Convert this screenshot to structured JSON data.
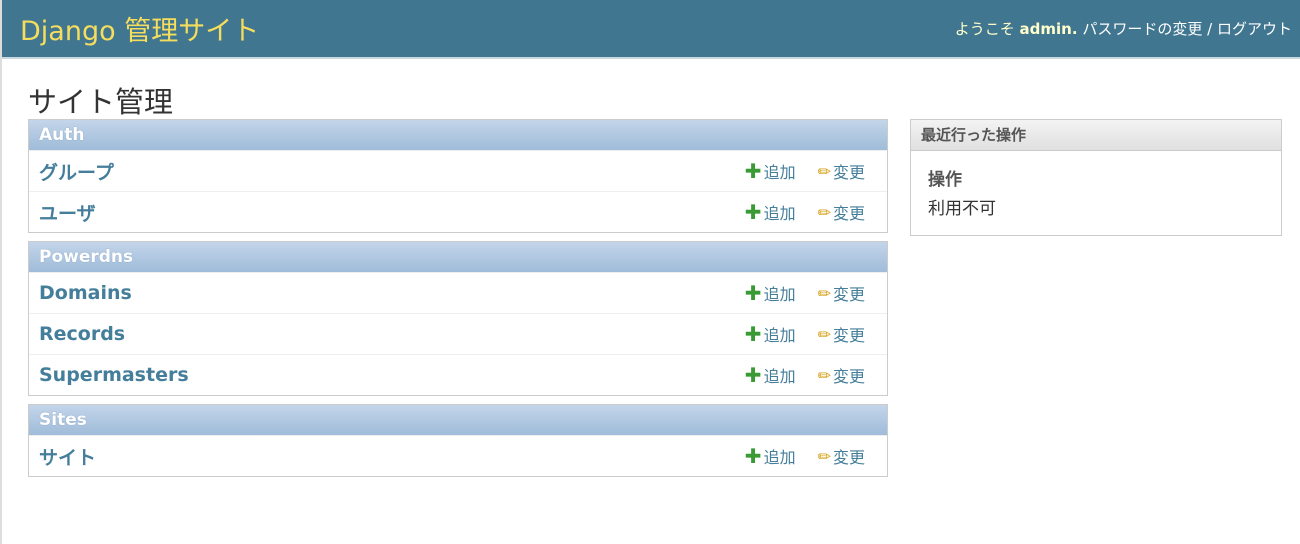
{
  "header": {
    "brand": "Django 管理サイト",
    "welcome": "ようこそ",
    "user": "admin.",
    "password_change": "パスワードの変更",
    "sep": "/",
    "logout": "ログアウト"
  },
  "title": "サイト管理",
  "add_label": "追加",
  "change_label": "変更",
  "apps": [
    {
      "name": "Auth",
      "models": [
        "グループ",
        "ユーザ"
      ]
    },
    {
      "name": "Powerdns",
      "models": [
        "Domains",
        "Records",
        "Supermasters"
      ]
    },
    {
      "name": "Sites",
      "models": [
        "サイト"
      ]
    }
  ],
  "recent": {
    "title": "最近行った操作",
    "heading": "操作",
    "empty": "利用不可"
  }
}
